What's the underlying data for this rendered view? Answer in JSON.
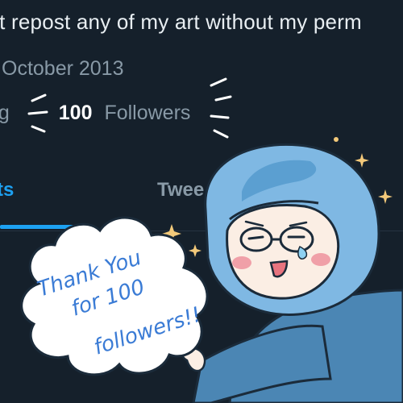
{
  "profile": {
    "bio_fragment": "'t repost any of my art without my perm",
    "joined": "October 2013",
    "following_fragment": "ng",
    "followers_count": "100",
    "followers_label": "Followers"
  },
  "tabs": {
    "current_fragment": "ts",
    "other_fragment": "Twee"
  },
  "speech_bubble": {
    "line1": "Thank You",
    "line2": "for 100",
    "line3": "followers!!"
  },
  "colors": {
    "background": "#15202b",
    "accent": "#1da1f2",
    "muted_text": "#8899a6",
    "hood_blue": "#7fb8e3",
    "bubble_text": "#3a7bd5",
    "sparkle": "#f3c97a"
  }
}
